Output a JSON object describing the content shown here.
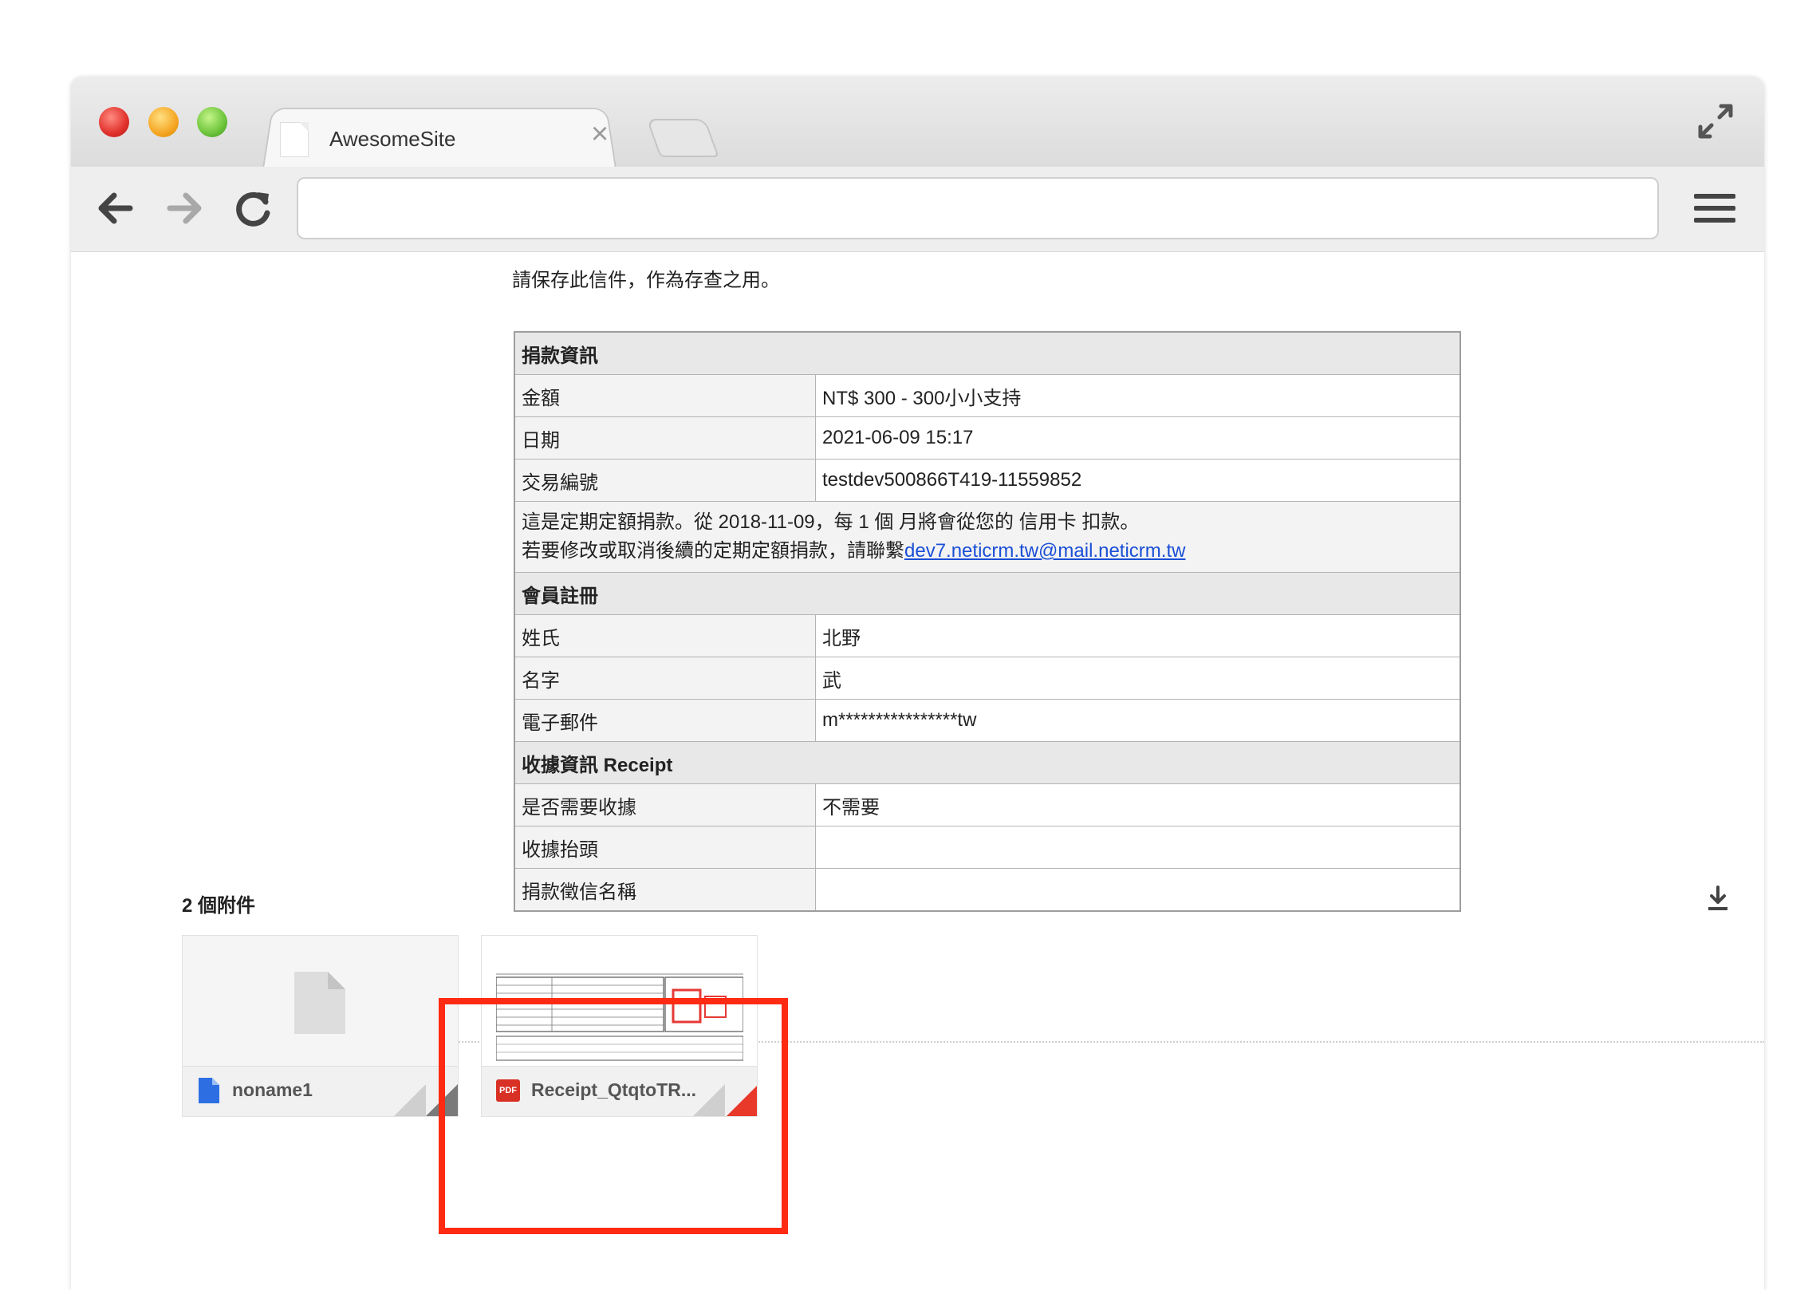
{
  "window": {
    "tab_title": "AwesomeSite",
    "tab_close": "×"
  },
  "icons": {
    "back": "arrow-left-icon",
    "forward": "arrow-right-icon",
    "reload": "reload-icon",
    "menu": "hamburger-menu-icon",
    "expand": "expand-icon",
    "download": "download-icon",
    "file": "file-icon",
    "pdf": "pdf-icon"
  },
  "colors": {
    "highlight": "#ff2a12",
    "link": "#1a4fd6",
    "pdf_red": "#d93025"
  },
  "email": {
    "note": "請保存此信件，作為存查之用。",
    "donation_section": "捐款資訊",
    "amount_label": "金額",
    "amount_value": "NT$ 300 - 300小小支持",
    "date_label": "日期",
    "date_value": "2021-06-09 15:17",
    "txn_label": "交易編號",
    "txn_value": "testdev500866T419-11559852",
    "recurring_line1": "這是定期定額捐款。從 2018-11-09，每 1 個 月將會從您的 信用卡 扣款。",
    "recurring_line2_prefix": "若要修改或取消後續的定期定額捐款，請聯繫",
    "recurring_link": "dev7.neticrm.tw@mail.neticrm.tw",
    "member_section": "會員註冊",
    "last_name_label": "姓氏",
    "last_name_value": "北野",
    "first_name_label": "名字",
    "first_name_value": "武",
    "email_label": "電子郵件",
    "email_value": "m****************tw",
    "receipt_section": "收據資訊 Receipt",
    "need_receipt_label": "是否需要收據",
    "need_receipt_value": "不需要",
    "receipt_title_label": "收據抬頭",
    "receipt_title_value": "",
    "donor_name_label": "捐款徵信名稱",
    "donor_name_value": ""
  },
  "attachments": {
    "count_label": "2 個附件",
    "items": [
      {
        "name": "noname1",
        "type": "file"
      },
      {
        "name": "Receipt_QtqtoTR...",
        "type": "pdf",
        "badge": "PDF"
      }
    ]
  }
}
